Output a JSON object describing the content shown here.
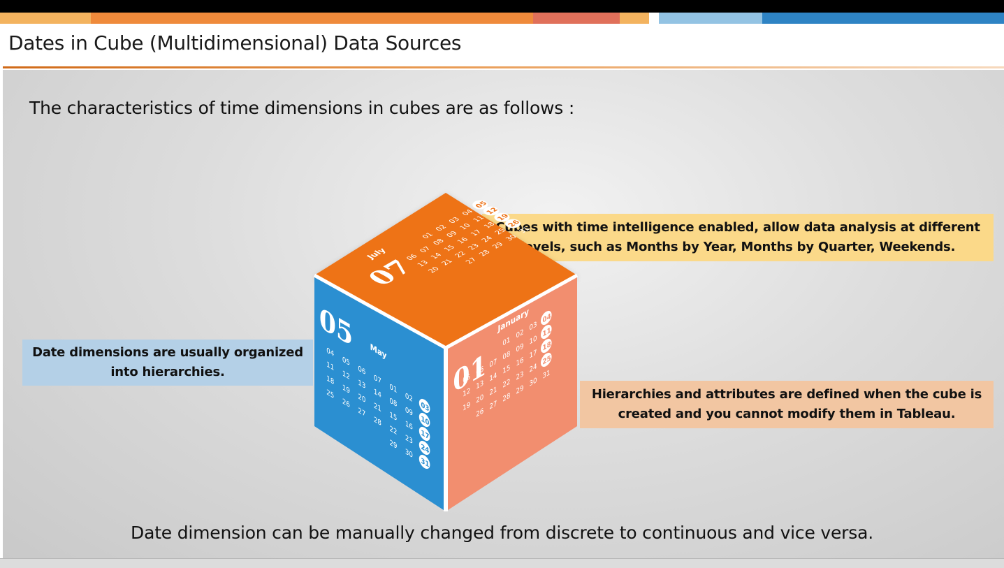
{
  "slide": {
    "title": "Dates in Cube (Multidimensional) Data Sources",
    "intro": "The characteristics of time dimensions in cubes are as follows :",
    "footer_statement": "Date dimension can be manually changed from discrete to continuous and vice versa.",
    "colors": {
      "orange": "#ee7318",
      "blue": "#2b8fd1",
      "salmon": "#f28e6f",
      "callout_yellow": "#fbd989",
      "callout_blue": "#b4d0e7",
      "callout_peach": "#f2c6a2"
    }
  },
  "callouts": {
    "top_line1": "Cubes with time intelligence enabled, allow data analysis at different",
    "top_line2": "levels, such as Months by Year, Months by Quarter, Weekends.",
    "left_line1": "Date dimensions are usually organized",
    "left_line2": "into hierarchies.",
    "right_line1": "Hierarchies and attributes are defined when the cube is",
    "right_line2": "created and you cannot modify them in Tableau."
  },
  "cube": {
    "top_face": {
      "number": "07",
      "month": "July",
      "rows": [
        [
          "01",
          "02",
          "03",
          "04",
          "05"
        ],
        [
          "06",
          "07",
          "08",
          "09",
          "10",
          "11",
          "12"
        ],
        [
          "13",
          "14",
          "15",
          "16",
          "17",
          "18",
          "19"
        ],
        [
          "20",
          "21",
          "22",
          "23",
          "24",
          "25",
          "26"
        ],
        [
          "27",
          "28",
          "29",
          "30",
          "31"
        ]
      ],
      "highlighted": [
        "05",
        "12",
        "19",
        "26"
      ]
    },
    "left_face": {
      "number": "05",
      "month": "May",
      "rows": [
        [
          "04",
          "05",
          "06",
          "07",
          "01",
          "02",
          "03"
        ],
        [
          "11",
          "12",
          "13",
          "14",
          "08",
          "09",
          "10"
        ],
        [
          "18",
          "19",
          "20",
          "21",
          "15",
          "16",
          "17"
        ],
        [
          "25",
          "26",
          "27",
          "28",
          "22",
          "23",
          "24"
        ],
        [
          "29",
          "30",
          "31"
        ]
      ],
      "highlighted": [
        "03",
        "10",
        "17",
        "24",
        "31"
      ]
    },
    "right_face": {
      "number": "01",
      "month": "January",
      "rows": [
        [
          "01",
          "02",
          "03",
          "04"
        ],
        [
          "05",
          "06",
          "07",
          "08",
          "09",
          "10",
          "11"
        ],
        [
          "12",
          "13",
          "14",
          "15",
          "16",
          "17",
          "18"
        ],
        [
          "19",
          "20",
          "21",
          "22",
          "23",
          "24",
          "25"
        ],
        [
          "26",
          "27",
          "28",
          "29",
          "30",
          "31"
        ]
      ],
      "highlighted": [
        "04",
        "11",
        "18",
        "25"
      ]
    }
  }
}
